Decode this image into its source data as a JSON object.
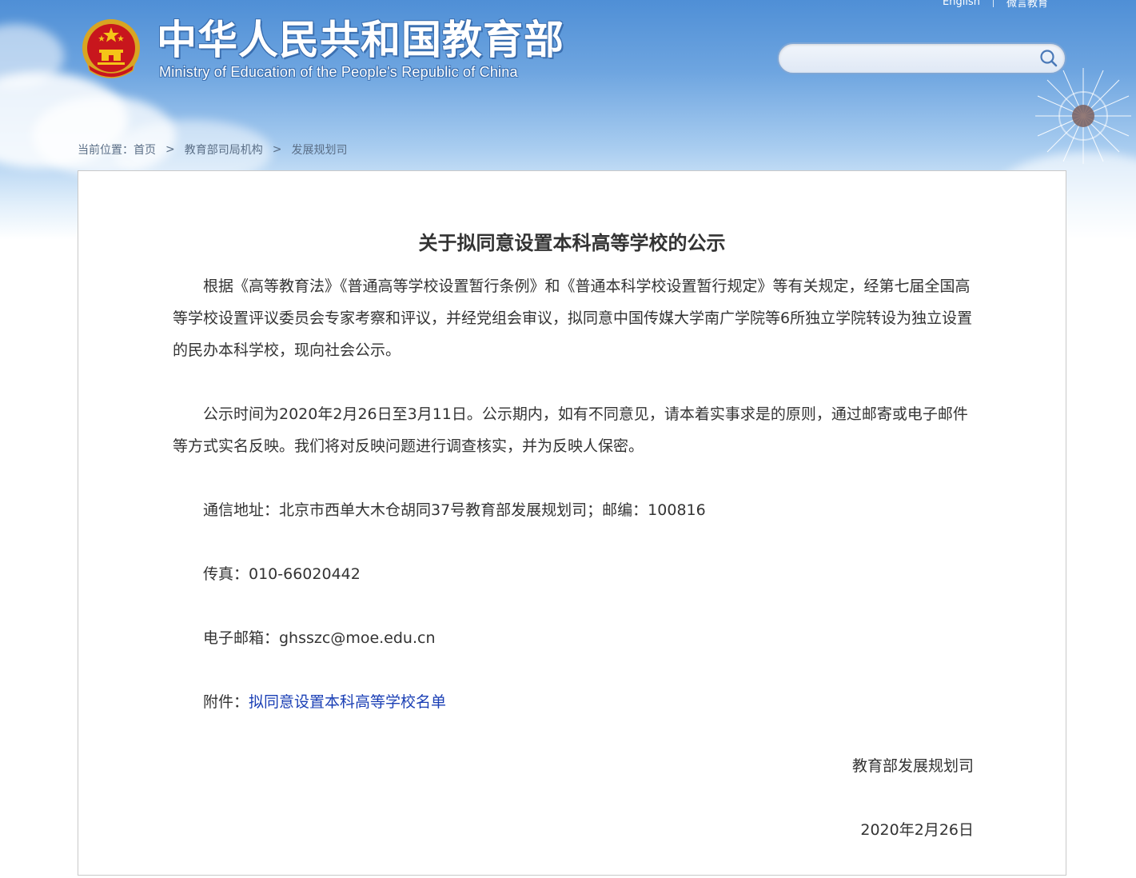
{
  "header": {
    "title_cn": "中华人民共和国教育部",
    "title_en": "Ministry of Education of the People's Republic of China",
    "top_links": [
      "English",
      "微言教育"
    ]
  },
  "search": {
    "placeholder": ""
  },
  "breadcrumb": {
    "label": "当前位置：",
    "items": [
      "首页",
      "教育部司局机构",
      "发展规划司"
    ]
  },
  "article": {
    "title": "关于拟同意设置本科高等学校的公示",
    "para1": "根据《高等教育法》《普通高等学校设置暂行条例》和《普通本科学校设置暂行规定》等有关规定，经第七届全国高等学校设置评议委员会专家考察和评议，并经党组会审议，拟同意中国传媒大学南广学院等6所独立学院转设为独立设置的民办本科学校，现向社会公示。",
    "para2": "公示时间为2020年2月26日至3月11日。公示期内，如有不同意见，请本着实事求是的原则，通过邮寄或电子邮件等方式实名反映。我们将对反映问题进行调查核实，并为反映人保密。",
    "address": "通信地址：北京市西单大木仓胡同37号教育部发展规划司；邮编：100816",
    "fax": "传真：010-66020442",
    "email": "电子邮箱：ghsszc@moe.edu.cn",
    "attachment_label": "附件：",
    "attachment_link": "拟同意设置本科高等学校名单",
    "signature": "教育部发展规划司",
    "date": "2020年2月26日"
  },
  "colors": {
    "link": "#1a3fb5",
    "text": "#333333",
    "breadcrumb": "#5a6e86"
  }
}
